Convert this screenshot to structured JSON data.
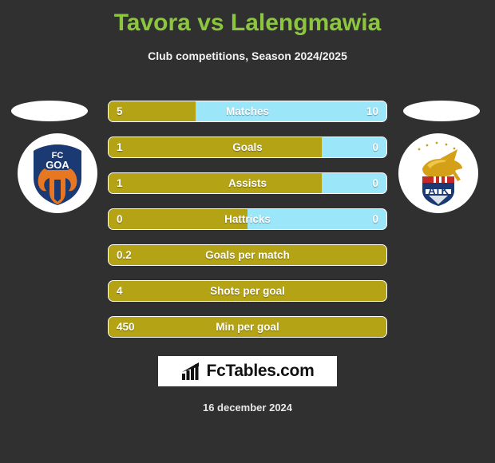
{
  "header": {
    "title": "Tavora vs Lalengmawia",
    "subtitle": "Club competitions, Season 2024/2025",
    "title_color": "#8CC63E"
  },
  "colors": {
    "background": "#303030",
    "home_bar": "#B5A316",
    "away_bar": "#9CE6FA",
    "text": "#ffffff"
  },
  "badges": {
    "home": {
      "name": "FC GOA",
      "line1": "FC",
      "line2": "GOA",
      "icon": "fc-goa-crest-icon"
    },
    "away": {
      "name": "ATK",
      "line1": "ATK",
      "icon": "atk-crest-icon"
    }
  },
  "chart_data": {
    "type": "bar",
    "title": "Tavora vs Lalengmawia",
    "subtitle": "Club competitions, Season 2024/2025",
    "orientation": "horizontal-diverging",
    "series": [
      {
        "name": "Tavora",
        "side": "home",
        "color": "#B5A316"
      },
      {
        "name": "Lalengmawia",
        "side": "away",
        "color": "#9CE6FA"
      }
    ],
    "categories": [
      "Matches",
      "Goals",
      "Assists",
      "Hattricks",
      "Goals per match",
      "Shots per goal",
      "Min per goal"
    ],
    "rows": [
      {
        "label": "Matches",
        "home": "5",
        "away": "10",
        "home_pct": 31.4,
        "split": true
      },
      {
        "label": "Goals",
        "home": "1",
        "away": "0",
        "home_pct": 76.6,
        "split": true
      },
      {
        "label": "Assists",
        "home": "1",
        "away": "0",
        "home_pct": 76.6,
        "split": true
      },
      {
        "label": "Hattricks",
        "home": "0",
        "away": "0",
        "home_pct": 50.0,
        "split": true
      },
      {
        "label": "Goals per match",
        "home": "0.2",
        "away": "",
        "home_pct": 100,
        "split": false
      },
      {
        "label": "Shots per goal",
        "home": "4",
        "away": "",
        "home_pct": 100,
        "split": false
      },
      {
        "label": "Min per goal",
        "home": "450",
        "away": "",
        "home_pct": 100,
        "split": false
      }
    ]
  },
  "footer": {
    "logo_text": "FcTables.com",
    "logo_icon": "bar-chart-trend-icon",
    "date": "16 december 2024"
  }
}
